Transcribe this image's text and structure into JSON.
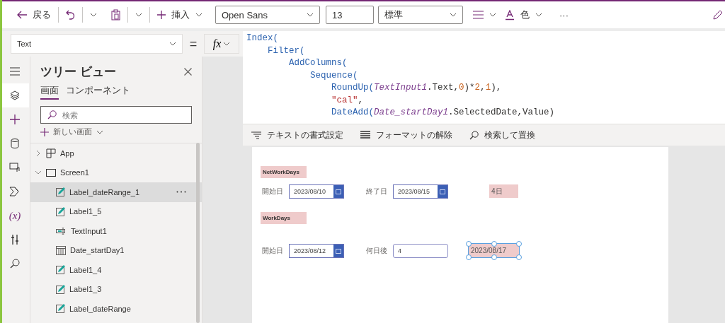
{
  "toolbar": {
    "back": "戻る",
    "insert": "挿入",
    "font": "Open Sans",
    "size": "13",
    "weight": "標準",
    "font_color_label": "色",
    "more": "···"
  },
  "formula_bar": {
    "property": "Text",
    "equals": "=",
    "fx": "fx",
    "lines": [
      [
        {
          "kind": "func",
          "text": "Index("
        }
      ],
      [
        {
          "kind": "func",
          "text": "    Filter("
        }
      ],
      [
        {
          "kind": "func",
          "text": "        AddColumns("
        }
      ],
      [
        {
          "kind": "func",
          "text": "            Sequence("
        }
      ],
      [
        {
          "kind": "func",
          "text": "                RoundUp("
        },
        {
          "kind": "ident",
          "text": "TextInput1"
        },
        {
          "kind": "plain",
          "text": ".Text,"
        },
        {
          "kind": "num",
          "text": "0"
        },
        {
          "kind": "plain",
          "text": ")*"
        },
        {
          "kind": "num",
          "text": "2"
        },
        {
          "kind": "plain",
          "text": ","
        },
        {
          "kind": "num",
          "text": "1"
        },
        {
          "kind": "plain",
          "text": "),"
        }
      ],
      [
        {
          "kind": "str",
          "text": "                \"cal\""
        },
        {
          "kind": "plain",
          "text": ","
        }
      ],
      [
        {
          "kind": "func",
          "text": "                DateAdd("
        },
        {
          "kind": "ident",
          "text": "Date_startDay1"
        },
        {
          "kind": "plain",
          "text": ".SelectedDate,Value)"
        }
      ]
    ],
    "tools": [
      {
        "kind": "format",
        "label": "テキストの書式設定"
      },
      {
        "kind": "clear",
        "label": "フォーマットの解除"
      },
      {
        "kind": "find",
        "label": "検索して置換"
      }
    ]
  },
  "rail": [
    {
      "kind": "menu",
      "selected": false
    },
    {
      "kind": "tree",
      "selected": true
    },
    {
      "kind": "insert",
      "selected": false
    },
    {
      "kind": "data",
      "selected": false
    },
    {
      "kind": "media",
      "selected": false
    },
    {
      "kind": "automate",
      "selected": false
    },
    {
      "kind": "variables",
      "selected": false,
      "label": "(x)"
    },
    {
      "kind": "tools",
      "selected": false
    },
    {
      "kind": "search",
      "selected": false
    }
  ],
  "tree_view": {
    "title": "ツリー ビュー",
    "tabs": [
      {
        "label": "画面",
        "selected": true
      },
      {
        "label": "コンポーネント",
        "selected": false
      }
    ],
    "search": {
      "placeholder": "検索"
    },
    "new_screen": "新しい画面",
    "items": [
      {
        "kind": "app",
        "label": "App",
        "expanded": false,
        "selected": false
      },
      {
        "kind": "screen",
        "label": "Screen1",
        "expanded": true,
        "selected": false,
        "children": [
          {
            "kind": "label",
            "label": "Label_dateRange_1",
            "selected": true
          },
          {
            "kind": "label",
            "label": "Label1_5",
            "selected": false
          },
          {
            "kind": "input",
            "label": "TextInput1",
            "selected": false
          },
          {
            "kind": "date",
            "label": "Date_startDay1",
            "selected": false
          },
          {
            "kind": "label",
            "label": "Label1_4",
            "selected": false
          },
          {
            "kind": "label",
            "label": "Label1_3",
            "selected": false
          },
          {
            "kind": "label",
            "label": "Label_dateRange",
            "selected": false
          }
        ]
      }
    ]
  },
  "canvas": {
    "sections": [
      {
        "title": "NetWorkDays",
        "controls": [
          {
            "kind": "caption",
            "text": "開始日"
          },
          {
            "kind": "date",
            "value": "2023/08/10"
          },
          {
            "kind": "caption",
            "text": "終了日"
          },
          {
            "kind": "date",
            "value": "2023/08/15"
          },
          {
            "kind": "result",
            "text": "4日",
            "selected": false
          }
        ]
      },
      {
        "title": "WorkDays",
        "controls": [
          {
            "kind": "caption",
            "text": "開始日"
          },
          {
            "kind": "date",
            "value": "2023/08/12"
          },
          {
            "kind": "caption",
            "text": "何日後"
          },
          {
            "kind": "input",
            "value": "4"
          },
          {
            "kind": "result",
            "text": "2023/08/17",
            "selected": true
          }
        ]
      }
    ]
  }
}
